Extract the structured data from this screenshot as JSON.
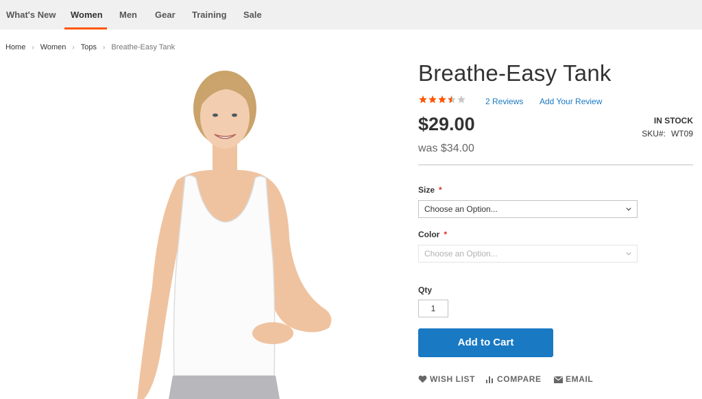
{
  "nav": {
    "items": [
      {
        "label": "What's New",
        "active": false
      },
      {
        "label": "Women",
        "active": true
      },
      {
        "label": "Men",
        "active": false
      },
      {
        "label": "Gear",
        "active": false
      },
      {
        "label": "Training",
        "active": false
      },
      {
        "label": "Sale",
        "active": false
      }
    ],
    "accent_color": "#ff5501"
  },
  "breadcrumb": {
    "items": [
      "Home",
      "Women",
      "Tops"
    ],
    "current": "Breathe-Easy Tank"
  },
  "product": {
    "title": "Breathe-Easy Tank",
    "rating": {
      "stars_filled": 3.5,
      "stars_total": 5,
      "star_color": "#ff5501"
    },
    "reviews_label": "2 Reviews",
    "add_review_label": "Add Your Review",
    "price": "$29.00",
    "old_price": "was $34.00",
    "stock_status": "IN STOCK",
    "sku_label": "SKU#:",
    "sku_value": "WT09",
    "image_icon": "product-photo-white-tank"
  },
  "options": {
    "size": {
      "label": "Size",
      "required_mark": "*",
      "value": "Choose an Option..."
    },
    "color": {
      "label": "Color",
      "required_mark": "*",
      "value": "Choose an Option..."
    }
  },
  "qty": {
    "label": "Qty",
    "value": "1"
  },
  "cart": {
    "button_label": "Add to Cart",
    "button_color": "#1979c3"
  },
  "actions": {
    "wishlist": {
      "label": "WISH LIST",
      "icon": "heart-icon"
    },
    "compare": {
      "label": "COMPARE",
      "icon": "bar-chart-icon"
    },
    "email": {
      "label": "EMAIL",
      "icon": "envelope-icon"
    }
  }
}
